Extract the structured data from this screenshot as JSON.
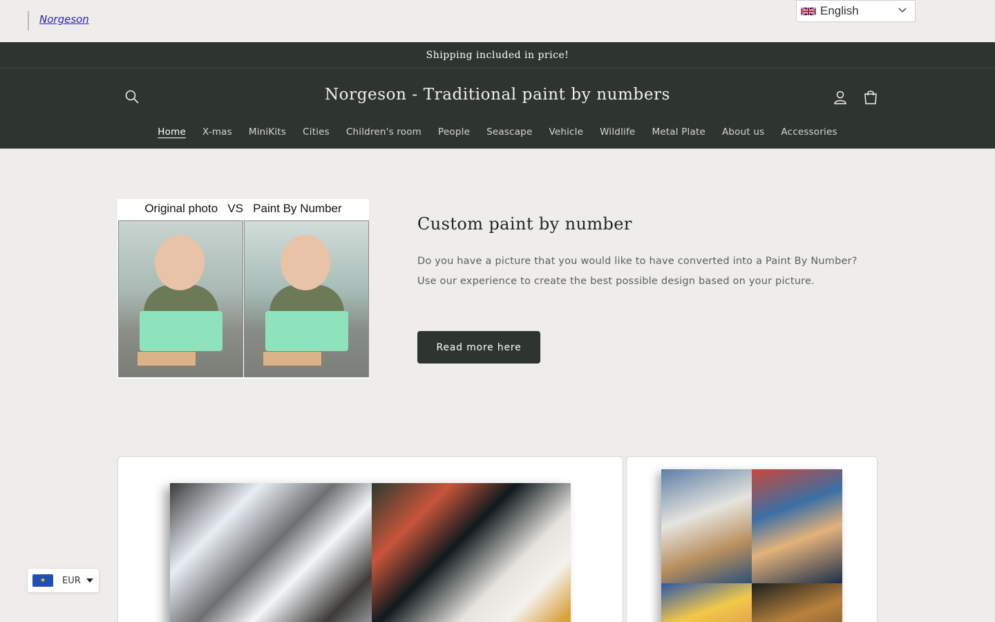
{
  "topbar": {
    "brand_link": "Norgeson",
    "language": {
      "label": "English",
      "flag_icon": "uk-flag-icon"
    }
  },
  "announcement": {
    "text": "Shipping included in price!"
  },
  "header": {
    "title": "Norgeson - Traditional paint by numbers",
    "icons": [
      "search-icon",
      "account-icon",
      "cart-icon"
    ]
  },
  "nav": {
    "items": [
      {
        "label": "Home",
        "active": true
      },
      {
        "label": "X-mas"
      },
      {
        "label": "MiniKits"
      },
      {
        "label": "Cities"
      },
      {
        "label": "Children's room"
      },
      {
        "label": "People"
      },
      {
        "label": "Seascape"
      },
      {
        "label": "Vehicle"
      },
      {
        "label": "Wildlife"
      },
      {
        "label": "Metal Plate"
      },
      {
        "label": "About us"
      },
      {
        "label": "Accessories"
      }
    ]
  },
  "hero": {
    "image_caption": "Original photo   VS   Paint By Number",
    "heading": "Custom paint by number",
    "paragraph_1": "Do you have a picture that you would like to have converted into a Paint By Number?",
    "paragraph_2": "Use our experience to create the best possible design based on your picture.",
    "button_label": "Read more here"
  },
  "currency": {
    "code": "EUR",
    "flag_icon": "eu-flag-icon"
  },
  "colors": {
    "header_bg": "#2e3531",
    "page_bg": "#efedeb",
    "link": "#1f1fbf"
  }
}
